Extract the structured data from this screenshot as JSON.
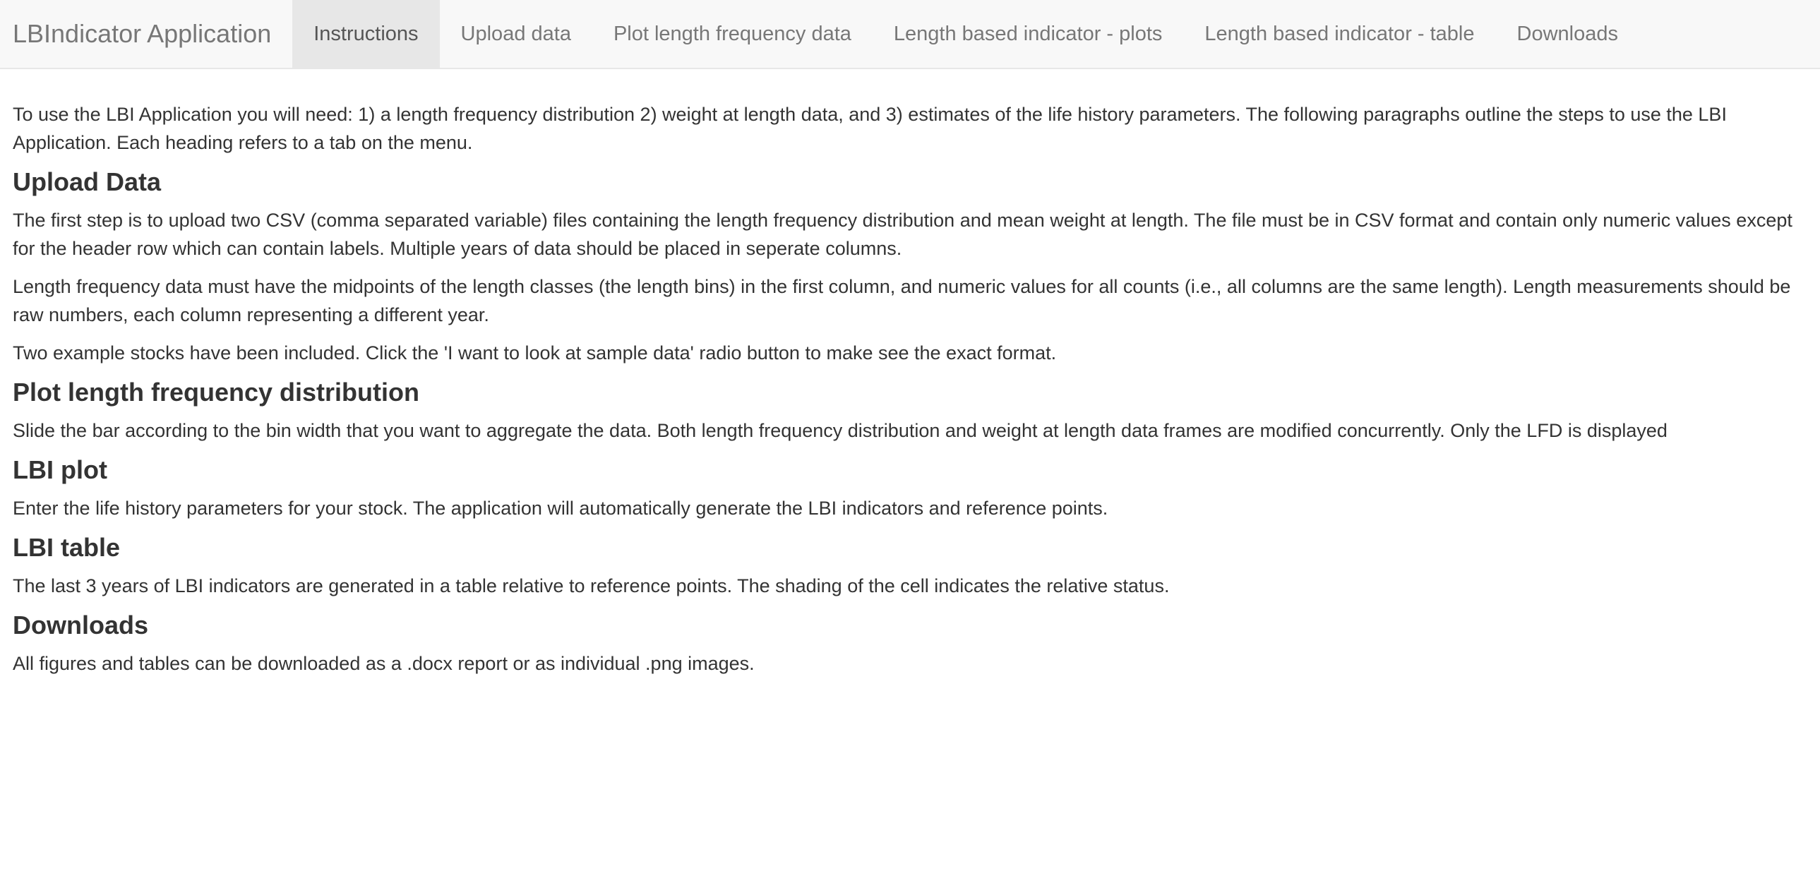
{
  "navbar": {
    "brand": "LBIndicator Application",
    "tabs": [
      {
        "label": "Instructions",
        "active": true
      },
      {
        "label": "Upload data",
        "active": false
      },
      {
        "label": "Plot length frequency data",
        "active": false
      },
      {
        "label": "Length based indicator - plots",
        "active": false
      },
      {
        "label": "Length based indicator - table",
        "active": false
      },
      {
        "label": "Downloads",
        "active": false
      }
    ]
  },
  "instructions": {
    "intro": "To use the LBI Application you will need: 1) a length frequency distribution 2) weight at length data, and 3) estimates of the life history parameters. The following paragraphs outline the steps to use the LBI Application. Each heading refers to a tab on the menu.",
    "upload": {
      "heading": "Upload Data",
      "p1": "The first step is to upload two CSV (comma separated variable) files containing the length frequency distribution and mean weight at length. The file must be in CSV format and contain only numeric values except for the header row which can contain labels. Multiple years of data should be placed in seperate columns.",
      "p2": "Length frequency data must have the midpoints of the length classes (the length bins) in the first column, and numeric values for all counts (i.e., all columns are the same length). Length measurements should be raw numbers, each column representing a different year.",
      "p3": "Two example stocks have been included. Click the 'I want to look at sample data' radio button to make see the exact format."
    },
    "plot_lfd": {
      "heading": "Plot length frequency distribution",
      "p1": "Slide the bar according to the bin width that you want to aggregate the data. Both length frequency distribution and weight at length data frames are modified concurrently. Only the LFD is displayed"
    },
    "lbi_plot": {
      "heading": "LBI plot",
      "p1": "Enter the life history parameters for your stock. The application will automatically generate the LBI indicators and reference points."
    },
    "lbi_table": {
      "heading": "LBI table",
      "p1": "The last 3 years of LBI indicators are generated in a table relative to reference points. The shading of the cell indicates the relative status."
    },
    "downloads": {
      "heading": "Downloads",
      "p1": "All figures and tables can be downloaded as a .docx report or as individual .png images."
    }
  }
}
